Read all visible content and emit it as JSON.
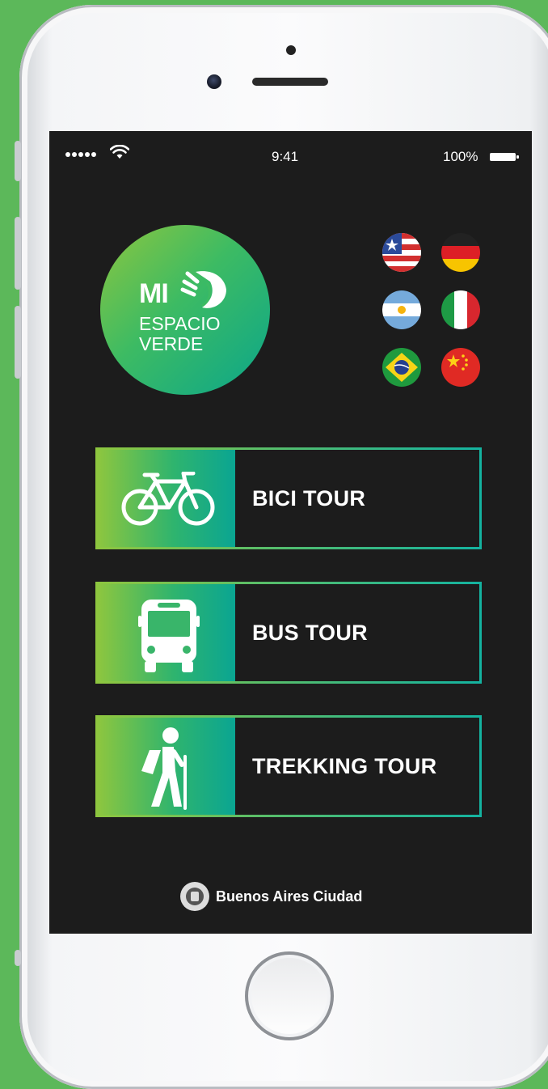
{
  "status_bar": {
    "time": "9:41",
    "battery_percent": "100%",
    "signal_dots": 5
  },
  "logo": {
    "line1": "MI",
    "line2": "ESPACIO",
    "line3": "VERDE"
  },
  "languages": [
    {
      "flag": "usa-flag-icon"
    },
    {
      "flag": "germany-flag-icon"
    },
    {
      "flag": "argentina-flag-icon"
    },
    {
      "flag": "italy-flag-icon"
    },
    {
      "flag": "brazil-flag-icon"
    },
    {
      "flag": "china-flag-icon"
    }
  ],
  "tours": [
    {
      "label": "BICI TOUR",
      "icon": "bicycle-icon"
    },
    {
      "label": "BUS TOUR",
      "icon": "bus-icon"
    },
    {
      "label": "TREKKING TOUR",
      "icon": "hiker-icon"
    }
  ],
  "footer": {
    "text": "Buenos Aires Ciudad",
    "icon": "city-crest-icon"
  },
  "colors": {
    "background": "#5cb85a",
    "screen": "#1c1c1c",
    "gradient_start": "#8dc63f",
    "gradient_end": "#0aa592"
  }
}
